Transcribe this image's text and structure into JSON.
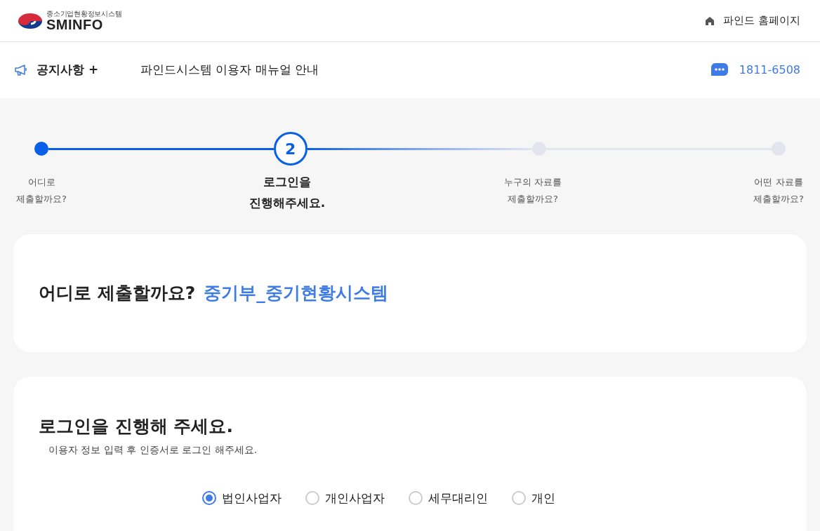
{
  "header": {
    "logo": {
      "subtitle": "중소기업현황정보시스템",
      "name": "SMINFO"
    },
    "home_link": "파인드 홈페이지"
  },
  "notice_bar": {
    "label": "공지사항 +",
    "notice": "파인드시스템 이용자 매뉴얼 안내",
    "phone": "1811-6508"
  },
  "steps": [
    {
      "label": [
        "어디로",
        "제출할까요?"
      ],
      "kind": "done"
    },
    {
      "number": "2",
      "label": [
        "로그인을",
        "진행해주세요."
      ],
      "kind": "current"
    },
    {
      "label": [
        "누구의 자료를",
        "제출할까요?"
      ],
      "kind": "todo"
    },
    {
      "label": [
        "어떤 자료를",
        "제출할까요?"
      ],
      "kind": "todo"
    }
  ],
  "destination_card": {
    "question": "어디로 제출할까요?",
    "answer": "중기부_중기현황시스템"
  },
  "login_card": {
    "title": "로그인을 진행해 주세요.",
    "subtitle": "이용자 정보 입력 후 인증서로 로그인 해주세요.",
    "user_types": [
      {
        "label": "법인사업자",
        "selected": true
      },
      {
        "label": "개인사업자",
        "selected": false
      },
      {
        "label": "세무대리인",
        "selected": false
      },
      {
        "label": "개인",
        "selected": false
      }
    ]
  }
}
